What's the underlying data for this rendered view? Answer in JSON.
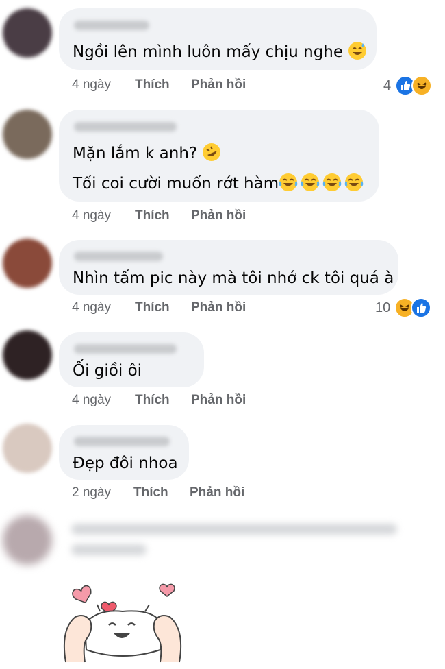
{
  "comments": [
    {
      "text": "Ngồi lên mình luôn mấy chịu nghe",
      "time": "4 ngày",
      "like": "Thích",
      "reply": "Phản hồi",
      "reaction_count": "4"
    },
    {
      "text": "Mặn lắm k anh?",
      "text2": "Tối coi cười muốn rớt hàm",
      "time": "4 ngày",
      "like": "Thích",
      "reply": "Phản hồi"
    },
    {
      "text": "Nhìn tấm pic này mà tôi nhớ ck tôi quá à",
      "time": "4 ngày",
      "like": "Thích",
      "reply": "Phản hồi",
      "reaction_count": "10"
    },
    {
      "text": "Ối giồi ôi",
      "time": "4 ngày",
      "like": "Thích",
      "reply": "Phản hồi"
    },
    {
      "text": "Đẹp đôi nhoa",
      "time": "2 ngày",
      "like": "Thích",
      "reply": "Phản hồi"
    }
  ],
  "colors": {
    "bubble": "#f0f2f5",
    "meta": "#65676b",
    "like_blue": "#1b74e4",
    "haha_yellow": "#f7b125"
  }
}
